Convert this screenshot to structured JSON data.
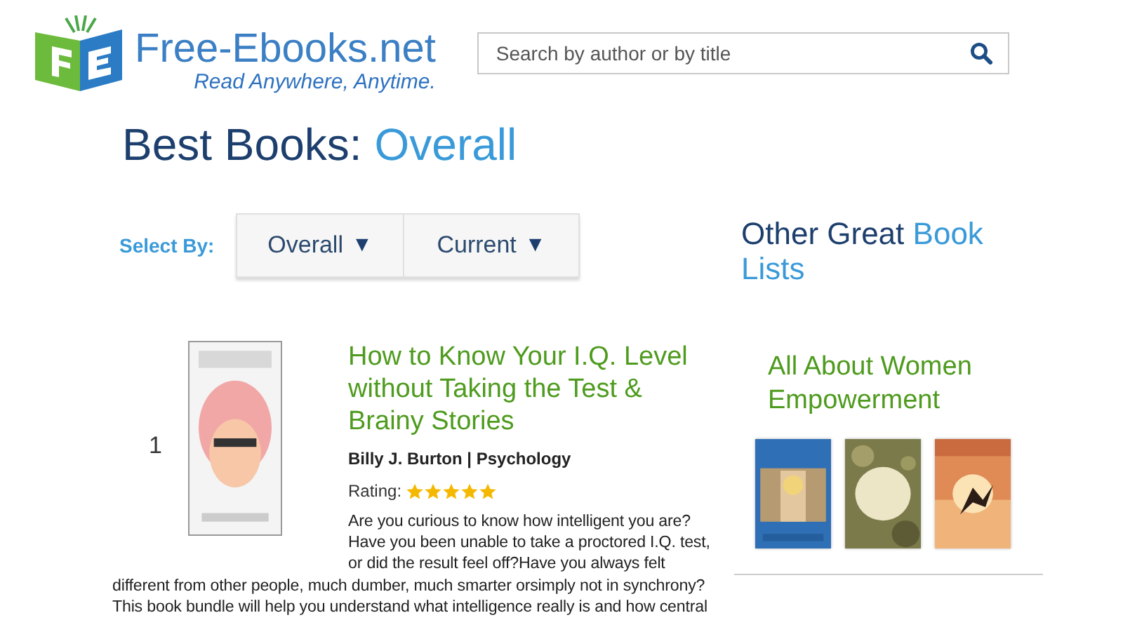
{
  "logo": {
    "name": "Free-Ebooks.net",
    "tagline": "Read Anywhere, Anytime."
  },
  "search": {
    "placeholder": "Search by author or by title"
  },
  "heading": {
    "prefix": "Best Books:",
    "highlight": "Overall"
  },
  "select_by": {
    "label": "Select By:",
    "dropdowns": [
      {
        "label": "Overall",
        "caret": "▼"
      },
      {
        "label": "Current",
        "caret": "▼"
      }
    ]
  },
  "books": [
    {
      "rank": "1",
      "title": "How to Know Your I.Q. Level without Taking the Test & Brainy Stories",
      "byline": "Billy J. Burton | Psychology",
      "rating_label": "Rating:",
      "stars": 5,
      "description": "Are you curious to know how intelligent you are? Have you been unable to take a proctored I.Q. test, or did the result feel off?Have you always felt different from other people, much dumber, much smarter orsimply not in synchrony? This book bundle will help you understand what intelligence really is and how central"
    }
  ],
  "sidebar": {
    "title_prefix": "Other Great",
    "title_highlight": "Book Lists",
    "lists": [
      {
        "title": "All About Women Empowerment"
      }
    ]
  }
}
